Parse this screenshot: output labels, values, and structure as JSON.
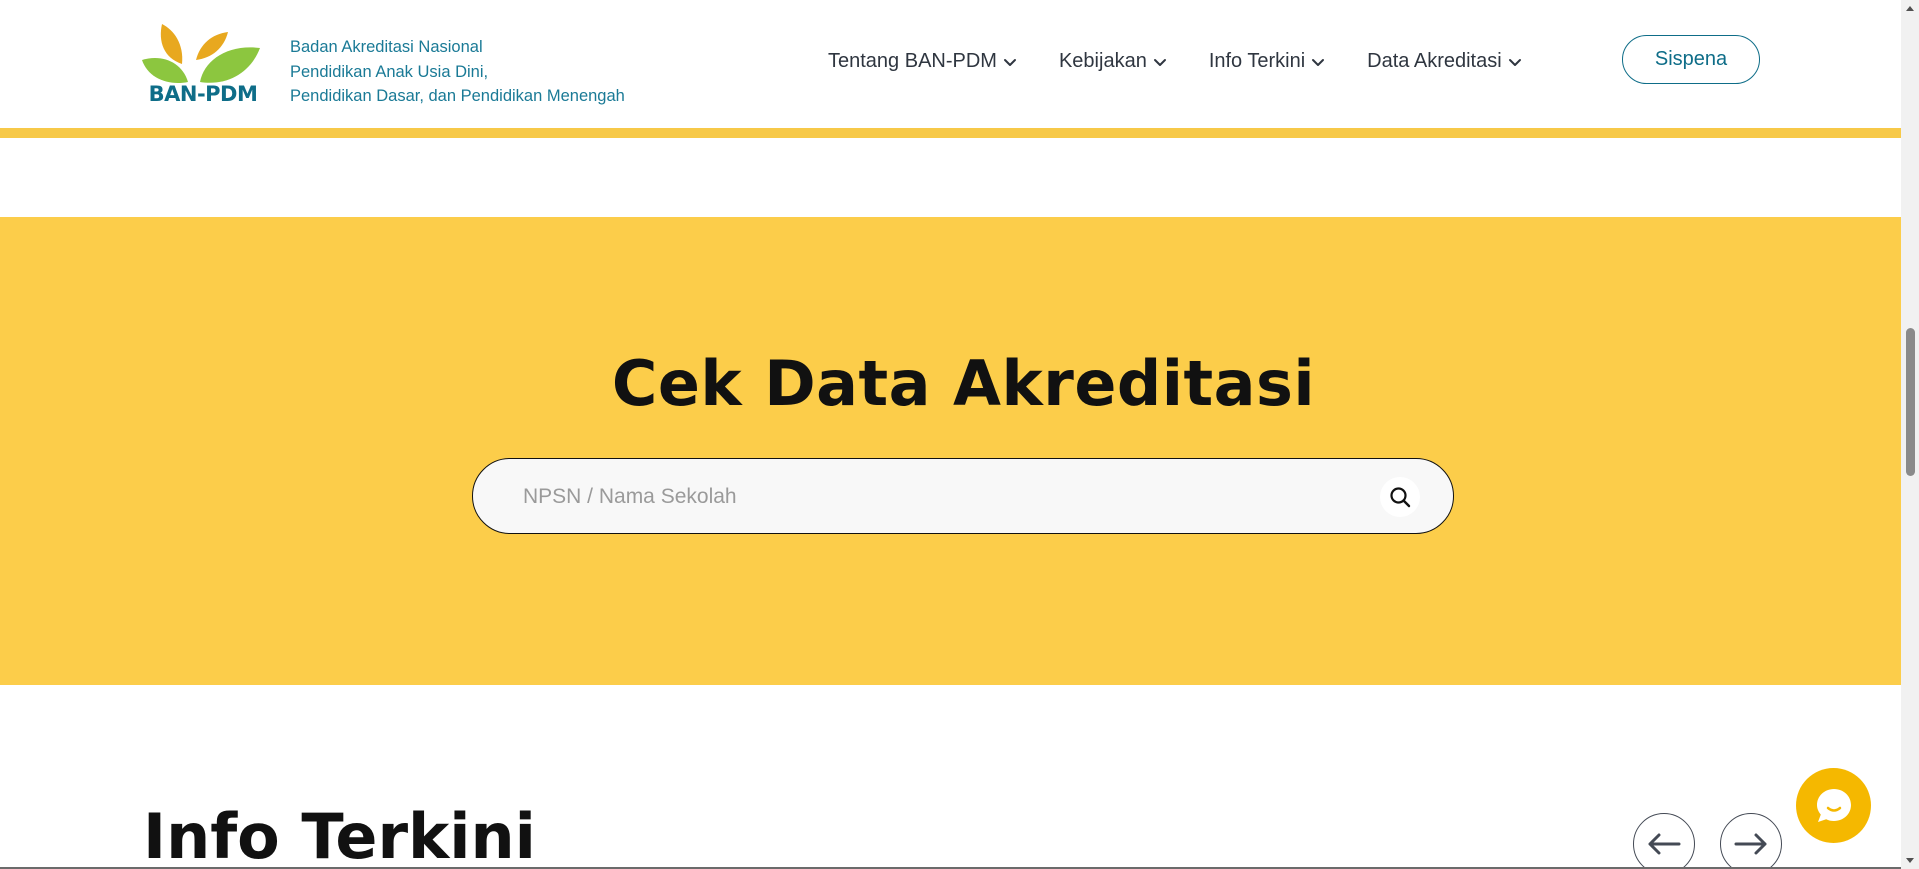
{
  "header": {
    "logo_text": "BAN-PDM",
    "org_name_lines": [
      "Badan Akreditasi Nasional",
      "Pendidikan Anak Usia Dini,",
      "Pendidikan Dasar, dan Pendidikan Menengah"
    ],
    "nav": [
      {
        "label": "Tentang BAN-PDM",
        "icon": "chevron-down-icon"
      },
      {
        "label": "Kebijakan",
        "icon": "chevron-down-icon"
      },
      {
        "label": "Info Terkini",
        "icon": "chevron-down-icon"
      },
      {
        "label": "Data Akreditasi",
        "icon": "chevron-down-icon"
      }
    ],
    "cta_label": "Sispena"
  },
  "hero": {
    "title": "Cek Data Akreditasi",
    "search": {
      "placeholder": "NPSN / Nama Sekolah",
      "value": "",
      "icon": "search-icon"
    }
  },
  "info_section": {
    "title": "Info Terkini",
    "prev_icon": "arrow-left-icon",
    "next_icon": "arrow-right-icon"
  },
  "chat": {
    "icon": "chat-bubble-icon"
  },
  "colors": {
    "brand_teal": "#0e6d88",
    "accent_yellow": "#fccd4a",
    "stripe_yellow": "#f7c948",
    "chat_yellow": "#f5b800",
    "leaf_green": "#8cc63f",
    "leaf_gold": "#e8a81f",
    "text_dark": "#111111"
  }
}
